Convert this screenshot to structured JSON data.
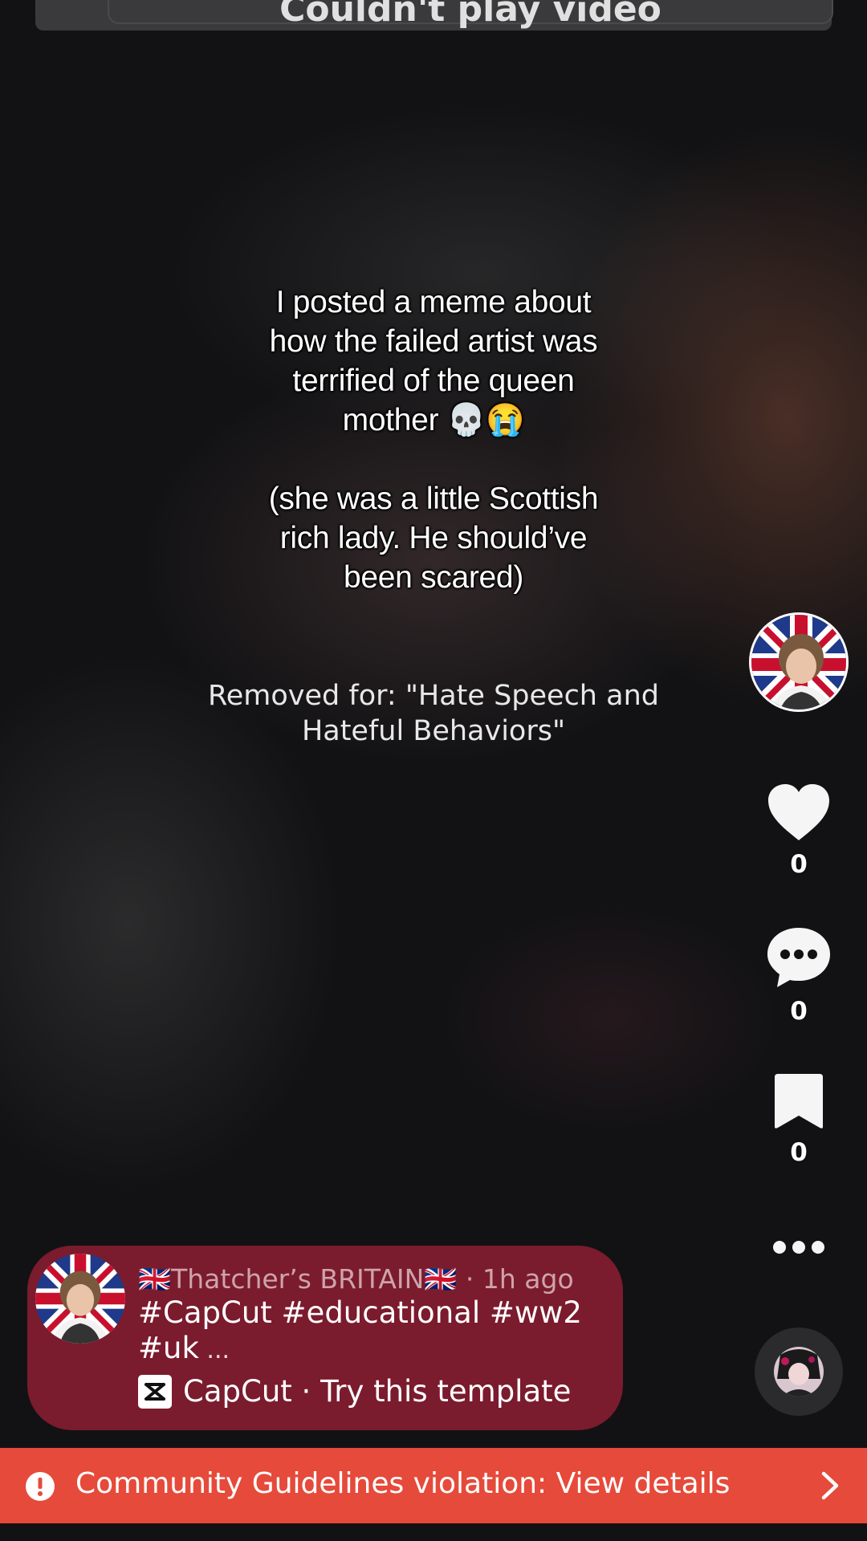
{
  "top_notice": {
    "label": "Couldn't play video"
  },
  "video": {
    "caption": "I posted a meme about\nhow the failed artist was\nterrified of the queen\nmother 💀😭\n\n(she was a little Scottish\nrich lady. He should’ve\nbeen scared)",
    "removed_notice": "Removed for: \"Hate Speech and Hateful Behaviors\""
  },
  "actions": {
    "likes": "0",
    "comments": "0",
    "saves": "0"
  },
  "info_card": {
    "author": "🇬🇧Thatcher’s BRITAIN🇬🇧",
    "time": " · 1h ago",
    "description_line1": "#CapCut #educational #ww2",
    "description_line2": "#uk",
    "ellipsis": " ...",
    "template_text": "CapCut · Try this template"
  },
  "violation_banner": {
    "text": "Community Guidelines violation: View details"
  },
  "colors": {
    "card_bg": "#7b1b2e",
    "banner_bg": "#e64a3a",
    "screen_bg": "#121214"
  },
  "icons": {
    "like": "heart-icon",
    "comment": "comment-bubble-icon",
    "save": "bookmark-icon",
    "more": "more-dots-icon",
    "alert": "alert-circle-icon",
    "chevron": "chevron-right-icon",
    "template": "capcut-icon"
  }
}
